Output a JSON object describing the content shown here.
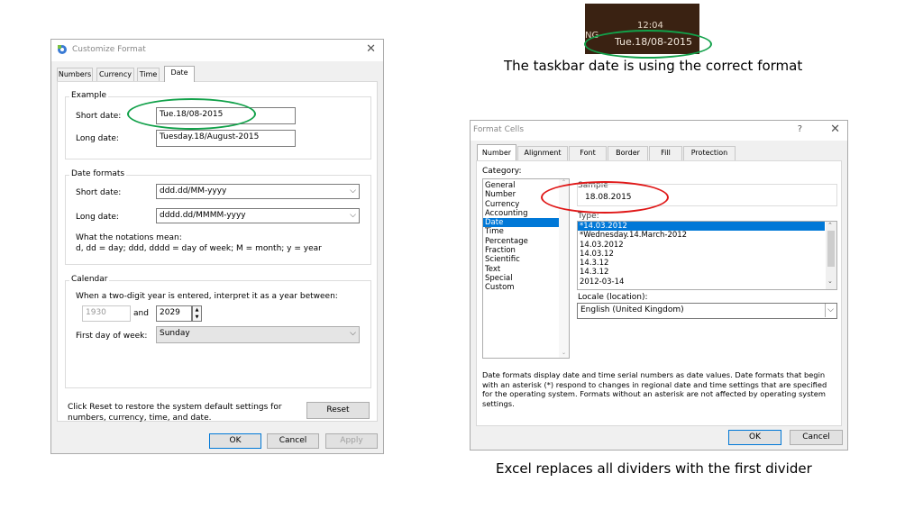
{
  "customize_format": {
    "title": "Customize Format",
    "tabs": [
      "Numbers",
      "Currency",
      "Time",
      "Date"
    ],
    "example": {
      "group_label": "Example",
      "short_label": "Short date:",
      "short_value": "Tue.18/08-2015",
      "long_label": "Long date:",
      "long_value": "Tuesday.18/August-2015"
    },
    "date_formats": {
      "group_label": "Date formats",
      "short_label": "Short date:",
      "short_value": "ddd.dd/MM-yyyy",
      "long_label": "Long date:",
      "long_value": "dddd.dd/MMMM-yyyy",
      "notations_heading": "What the notations mean:",
      "notations_text": "d, dd = day;  ddd, dddd = day of week;  M = month;  y = year"
    },
    "calendar": {
      "group_label": "Calendar",
      "two_digit_text": "When a two-digit year is entered, interpret it as a year between:",
      "from_year": "1930",
      "and_label": "and",
      "to_year": "2029",
      "first_day_label": "First day of week:",
      "first_day_value": "Sunday"
    },
    "reset_text_line1": "Click Reset to restore the system default settings for",
    "reset_text_line2": "numbers, currency, time, and date.",
    "reset_label": "Reset",
    "ok_label": "OK",
    "cancel_label": "Cancel",
    "apply_label": "Apply"
  },
  "taskbar": {
    "time": "12:04",
    "date": "Tue.18/08-2015",
    "lang_fragment": "NG"
  },
  "captions": {
    "taskbar": "The taskbar date is using the correct format",
    "excel": "Excel replaces all dividers with the first divider"
  },
  "format_cells": {
    "title": "Format Cells",
    "help": "?",
    "tabs": [
      "Number",
      "Alignment",
      "Font",
      "Border",
      "Fill",
      "Protection"
    ],
    "category_label": "Category:",
    "categories": [
      "General",
      "Number",
      "Currency",
      "Accounting",
      "Date",
      "Time",
      "Percentage",
      "Fraction",
      "Scientific",
      "Text",
      "Special",
      "Custom"
    ],
    "selected_category": "Date",
    "sample_label": "Sample",
    "sample_value": "18.08.2015",
    "type_label": "Type:",
    "types": [
      "*14.03.2012",
      "*Wednesday.14.March-2012",
      "14.03.2012",
      "14.03.12",
      "14.3.12",
      "14.3.12",
      "2012-03-14"
    ],
    "locale_label": "Locale (location):",
    "locale_value": "English (United Kingdom)",
    "description": "Date formats display date and time serial numbers as date values.  Date formats that begin with an asterisk (*) respond to changes in regional date and time settings that are specified for the operating system. Formats without an asterisk are not affected by operating system settings.",
    "ok_label": "OK",
    "cancel_label": "Cancel"
  },
  "colors": {
    "green_highlight": "#12a14a",
    "red_highlight": "#e01818",
    "selection": "#0078d7",
    "taskbar_bg": "#3a2212"
  },
  "icons": {
    "close": "close-icon",
    "chevron": "chevron-down-icon"
  }
}
